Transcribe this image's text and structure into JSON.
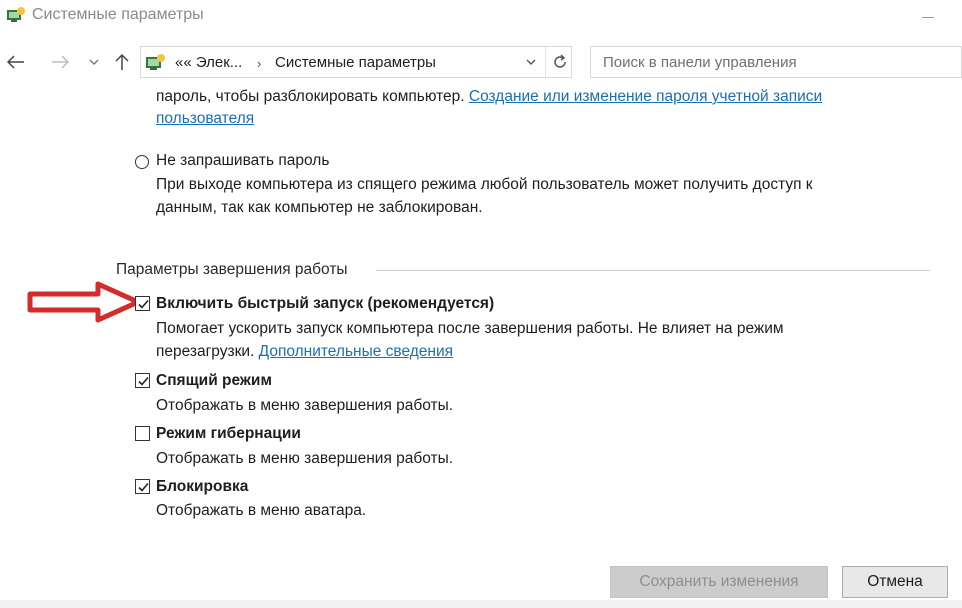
{
  "window": {
    "title": "Системные параметры"
  },
  "nav": {
    "breadcrumb": [
      "«« Элек...",
      "Системные параметры"
    ],
    "search_placeholder": "Поиск в панели управления"
  },
  "password_section": {
    "require_text": "пароль, чтобы разблокировать компьютер.",
    "require_link": "Создание или изменение пароля учетной записи",
    "require_link_cont": "пользователя",
    "no_password_label": "Не запрашивать пароль",
    "no_password_selected": false,
    "no_password_desc_1": "При выходе компьютера из спящего режима любой пользователь может получить доступ к",
    "no_password_desc_2": "данным, так как компьютер не заблокирован."
  },
  "shutdown_section": {
    "title": "Параметры завершения работы",
    "options": [
      {
        "label": "Включить быстрый запуск (рекомендуется)",
        "checked": true,
        "desc_1": "Помогает ускорить запуск компьютера после завершения работы. Не влияет на режим",
        "desc_2": "перезагрузки.",
        "link": "Дополнительные сведения"
      },
      {
        "label": "Спящий режим",
        "checked": true,
        "desc_1": "Отображать в меню завершения работы."
      },
      {
        "label": "Режим гибернации",
        "checked": false,
        "desc_1": "Отображать в меню завершения работы."
      },
      {
        "label": "Блокировка",
        "checked": true,
        "desc_1": "Отображать в меню аватара."
      }
    ]
  },
  "footer": {
    "save_label": "Сохранить изменения",
    "cancel_label": "Отмена"
  },
  "colors": {
    "link": "#1a6fb5",
    "arrow": "#d52b2b",
    "disabled_button": "#cccccc"
  }
}
